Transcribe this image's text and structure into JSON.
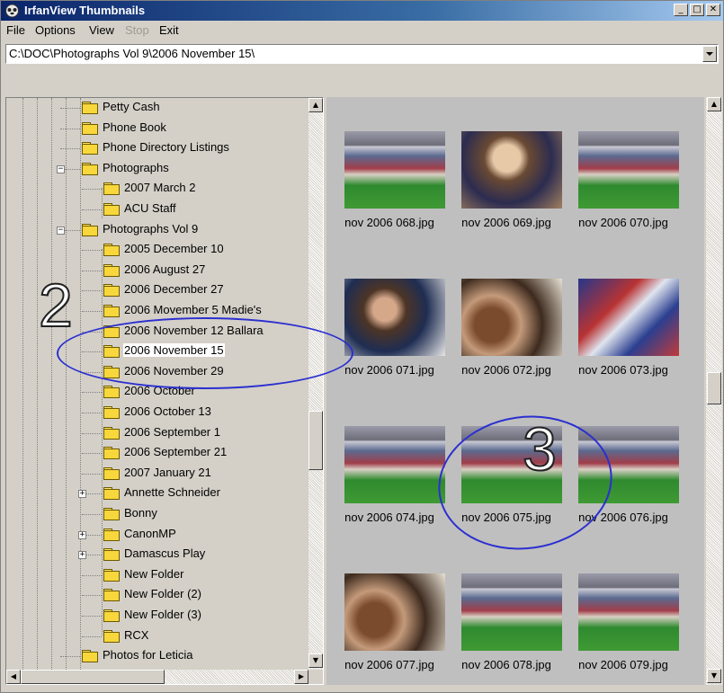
{
  "window": {
    "title": "IrfanView Thumbnails"
  },
  "titlebar_buttons": {
    "minimize": "_",
    "maximize": "□",
    "close": "✕"
  },
  "menu": {
    "file": "File",
    "options": "Options",
    "view": "View",
    "stop": "Stop",
    "exit": "Exit"
  },
  "address": {
    "path": "C:\\DOC\\Photographs Vol 9\\2006 November 15\\"
  },
  "tree": {
    "items": [
      {
        "label": "Petty Cash"
      },
      {
        "label": "Phone Book"
      },
      {
        "label": "Phone Directory Listings"
      },
      {
        "label": "Photographs"
      },
      {
        "label": "2007 March 2"
      },
      {
        "label": "ACU Staff"
      },
      {
        "label": "Photographs Vol 9"
      },
      {
        "label": "2005 December 10"
      },
      {
        "label": "2006 August 27"
      },
      {
        "label": "2006 December 27"
      },
      {
        "label": "2006 Movember 5 Madie's"
      },
      {
        "label": "2006 November 12 Ballara"
      },
      {
        "label": "2006 November 15"
      },
      {
        "label": "2006 November 29"
      },
      {
        "label": "2006 October"
      },
      {
        "label": "2006 October 13"
      },
      {
        "label": "2006 September 1"
      },
      {
        "label": "2006 September 21"
      },
      {
        "label": "2007 January 21"
      },
      {
        "label": "Annette Schneider"
      },
      {
        "label": "Bonny"
      },
      {
        "label": "CanonMP"
      },
      {
        "label": "Damascus Play"
      },
      {
        "label": "New Folder"
      },
      {
        "label": "New Folder (2)"
      },
      {
        "label": "New Folder (3)"
      },
      {
        "label": "RCX"
      },
      {
        "label": "Photos for Leticia"
      }
    ]
  },
  "thumbnails": [
    {
      "caption": "nov 2006 068.jpg"
    },
    {
      "caption": "nov 2006 069.jpg"
    },
    {
      "caption": "nov 2006 070.jpg"
    },
    {
      "caption": "nov 2006 071.jpg"
    },
    {
      "caption": "nov 2006 072.jpg"
    },
    {
      "caption": "nov 2006 073.jpg"
    },
    {
      "caption": "nov 2006 074.jpg"
    },
    {
      "caption": "nov 2006 075.jpg"
    },
    {
      "caption": "nov 2006 076.jpg"
    },
    {
      "caption": "nov 2006 077.jpg"
    },
    {
      "caption": "nov 2006 078.jpg"
    },
    {
      "caption": "nov 2006 079.jpg"
    }
  ],
  "annotations": {
    "marker_2": "2",
    "marker_3": "3",
    "circle_color": "#2b2fd0"
  }
}
